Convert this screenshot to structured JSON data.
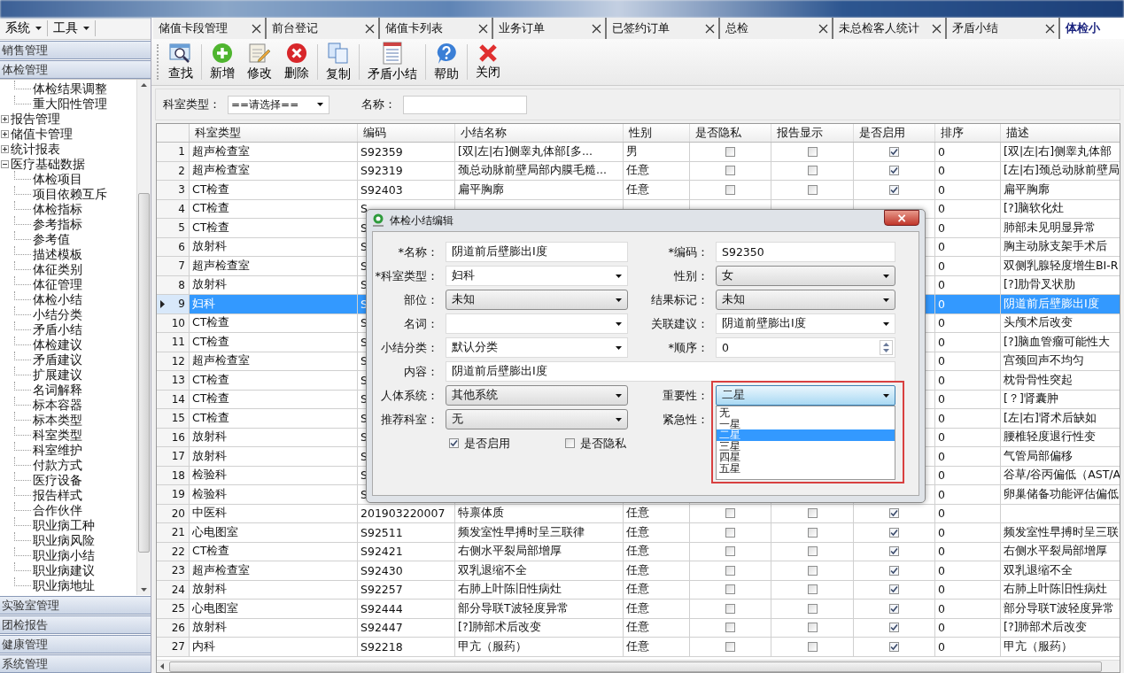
{
  "menu_bar": [
    {
      "label": "系统"
    },
    {
      "label": "工具"
    }
  ],
  "sidebar": {
    "sections_top": [
      {
        "label": "销售管理"
      },
      {
        "label": "体检管理"
      }
    ],
    "tree": {
      "scrolled_children": [
        "体检结果调整",
        "重大阳性管理"
      ],
      "nodes": [
        {
          "label": "报告管理",
          "expanded": false
        },
        {
          "label": "储值卡管理",
          "expanded": false
        },
        {
          "label": "统计报表",
          "expanded": false
        },
        {
          "label": "医疗基础数据",
          "expanded": true,
          "children": [
            "体检项目",
            "项目依赖互斥",
            "体检指标",
            "参考指标",
            "参考值",
            "描述模板",
            "体征类别",
            "体征管理",
            "体检小结",
            "小结分类",
            "矛盾小结",
            "体检建议",
            "矛盾建议",
            "扩展建议",
            "名词解释",
            "标本容器",
            "标本类型",
            "科室类型",
            "科室维护",
            "付款方式",
            "医疗设备",
            "报告样式",
            "合作伙伴",
            "职业病工种",
            "职业病风险",
            "职业病小结",
            "职业病建议",
            "职业病地址"
          ]
        }
      ]
    },
    "sections_bottom": [
      {
        "label": "实验室管理"
      },
      {
        "label": "团检报告"
      },
      {
        "label": "健康管理"
      },
      {
        "label": "系统管理"
      }
    ]
  },
  "tabs": [
    {
      "label": "储值卡段管理",
      "selected": false
    },
    {
      "label": "前台登记",
      "selected": false
    },
    {
      "label": "储值卡列表",
      "selected": false
    },
    {
      "label": "业务订单",
      "selected": false
    },
    {
      "label": "已签约订单",
      "selected": false
    },
    {
      "label": "总检",
      "selected": false
    },
    {
      "label": "未总检客人统计",
      "selected": false
    },
    {
      "label": "矛盾小结",
      "selected": false
    },
    {
      "label": "体检小",
      "selected": true
    }
  ],
  "toolbar": [
    {
      "label": "查找",
      "kind": "search"
    },
    {
      "label": "新增",
      "kind": "add"
    },
    {
      "label": "修改",
      "kind": "edit"
    },
    {
      "label": "删除",
      "kind": "delete"
    },
    {
      "label": "复制",
      "kind": "copy"
    },
    {
      "label": "矛盾小结",
      "kind": "list"
    },
    {
      "label": "帮助",
      "kind": "help"
    },
    {
      "label": "关闭",
      "kind": "close"
    }
  ],
  "filter": [
    {
      "label": "科室类型：",
      "kind": "select",
      "value": "==请选择=="
    },
    {
      "label": "名称：",
      "kind": "text"
    }
  ],
  "table": {
    "columns": [
      "科室类型",
      "编码",
      "小结名称",
      "性别",
      "是否隐私",
      "报告显示",
      "是否启用",
      "排序",
      "描述"
    ],
    "rows": [
      {
        "number": "1",
        "selected": false,
        "department": "超声检查室",
        "code": "S92359",
        "summary_name": "[双|左|右]侧睾丸体部[多...",
        "sex": "男",
        "private": false,
        "report_shown": false,
        "enabled": true,
        "sort": "0",
        "description": "[双|左|右]侧睾丸体部"
      },
      {
        "number": "2",
        "selected": false,
        "department": "超声检查室",
        "code": "S92319",
        "summary_name": "颈总动脉前壁局部内膜毛糙...",
        "sex": "任意",
        "private": false,
        "report_shown": false,
        "enabled": true,
        "sort": "0",
        "description": "[左|右]颈总动脉前壁局"
      },
      {
        "number": "3",
        "selected": false,
        "department": "CT检查",
        "code": "S92403",
        "summary_name": "扁平胸廓",
        "sex": "任意",
        "private": false,
        "report_shown": false,
        "enabled": true,
        "sort": "0",
        "description": "扁平胸廓"
      },
      {
        "number": "4",
        "selected": false,
        "department": "CT检查",
        "code": "S",
        "sort": "0",
        "description": "[?]脑软化灶"
      },
      {
        "number": "5",
        "selected": false,
        "department": "CT检查",
        "code": "S",
        "sort": "0",
        "description": "肺部未见明显异常"
      },
      {
        "number": "6",
        "selected": false,
        "department": "放射科",
        "code": "S",
        "sort": "0",
        "description": "胸主动脉支架手术后"
      },
      {
        "number": "7",
        "selected": false,
        "department": "超声检查室",
        "code": "S",
        "sort": "0",
        "description": "双侧乳腺轻度增生BI-R"
      },
      {
        "number": "8",
        "selected": false,
        "department": "放射科",
        "code": "S",
        "sort": "0",
        "description": "[?]肋骨叉状肋"
      },
      {
        "number": "9",
        "selected": true,
        "department": "妇科",
        "code": "S",
        "sort": "0",
        "description": "阴道前后壁膨出I度"
      },
      {
        "number": "10",
        "selected": false,
        "department": "CT检查",
        "code": "S",
        "sort": "0",
        "description": "头颅术后改变"
      },
      {
        "number": "11",
        "selected": false,
        "department": "CT检查",
        "code": "S",
        "sort": "0",
        "description": "[?]脑血管瘤可能性大"
      },
      {
        "number": "12",
        "selected": false,
        "department": "超声检查室",
        "code": "S",
        "sort": "0",
        "description": "宫颈回声不均匀"
      },
      {
        "number": "13",
        "selected": false,
        "department": "CT检查",
        "code": "S",
        "sort": "0",
        "description": "枕骨骨性突起"
      },
      {
        "number": "14",
        "selected": false,
        "department": "CT检查",
        "code": "S",
        "sort": "0",
        "description": "[？]肾囊肿"
      },
      {
        "number": "15",
        "selected": false,
        "department": "CT检查",
        "code": "S",
        "sort": "0",
        "description": "[左|右]肾术后缺如"
      },
      {
        "number": "16",
        "selected": false,
        "department": "放射科",
        "code": "S",
        "sort": "0",
        "description": "腰椎轻度退行性变"
      },
      {
        "number": "17",
        "selected": false,
        "department": "放射科",
        "code": "S",
        "sort": "0",
        "description": "气管局部偏移"
      },
      {
        "number": "18",
        "selected": false,
        "department": "检验科",
        "code": "S",
        "sort": "0",
        "description": "谷草/谷丙偏低（AST/A"
      },
      {
        "number": "19",
        "selected": false,
        "department": "检验科",
        "code": "S",
        "sort": "0",
        "description": "卵巢储备功能评估偏低"
      },
      {
        "number": "20",
        "selected": false,
        "department": "中医科",
        "code": "201903220007",
        "summary_name": "特禀体质",
        "sex": "任意",
        "private": false,
        "report_shown": false,
        "enabled": true,
        "sort": "0"
      },
      {
        "number": "21",
        "selected": false,
        "department": "心电图室",
        "code": "S92511",
        "summary_name": "频发室性早搏时呈三联律",
        "sex": "任意",
        "private": false,
        "report_shown": false,
        "enabled": true,
        "sort": "0",
        "description": "频发室性早搏时呈三联"
      },
      {
        "number": "22",
        "selected": false,
        "department": "CT检查",
        "code": "S92421",
        "summary_name": "右侧水平裂局部增厚",
        "sex": "任意",
        "private": false,
        "report_shown": false,
        "enabled": true,
        "sort": "0",
        "description": "右侧水平裂局部增厚"
      },
      {
        "number": "23",
        "selected": false,
        "department": "超声检查室",
        "code": "S92430",
        "summary_name": "双乳退缩不全",
        "sex": "任意",
        "private": false,
        "report_shown": false,
        "enabled": true,
        "sort": "0",
        "description": "双乳退缩不全"
      },
      {
        "number": "24",
        "selected": false,
        "department": "放射科",
        "code": "S92257",
        "summary_name": "右肺上叶陈旧性病灶",
        "sex": "任意",
        "private": false,
        "report_shown": false,
        "enabled": true,
        "sort": "0",
        "description": "右肺上叶陈旧性病灶"
      },
      {
        "number": "25",
        "selected": false,
        "department": "心电图室",
        "code": "S92444",
        "summary_name": "部分导联T波轻度异常",
        "sex": "任意",
        "private": false,
        "report_shown": false,
        "enabled": true,
        "sort": "0",
        "description": "部分导联T波轻度异常"
      },
      {
        "number": "26",
        "selected": false,
        "department": "放射科",
        "code": "S92447",
        "summary_name": "[?]肺部术后改变",
        "sex": "任意",
        "private": false,
        "report_shown": false,
        "enabled": true,
        "sort": "0",
        "description": "[?]肺部术后改变"
      },
      {
        "number": "27",
        "selected": false,
        "department": "内科",
        "code": "S92218",
        "summary_name": "甲亢（服药）",
        "sex": "任意",
        "private": false,
        "report_shown": false,
        "enabled": true,
        "sort": "0",
        "description": "甲亢（服药）"
      }
    ]
  },
  "dialog": {
    "title": "体检小结编辑",
    "close": "×",
    "rows": [
      {
        "kind": "pair",
        "items": [
          {
            "label": "*名称：",
            "kind": "text",
            "value": "阴道前后壁膨出I度"
          },
          {
            "label": "*编码：",
            "kind": "text",
            "value": "S92350"
          }
        ]
      },
      {
        "kind": "pair",
        "items": [
          {
            "label": "*科室类型：",
            "kind": "combo",
            "value": "妇科"
          },
          {
            "label": "性别：",
            "kind": "select",
            "value": "女"
          }
        ]
      },
      {
        "kind": "pair",
        "items": [
          {
            "label": "部位：",
            "kind": "select",
            "value": "未知"
          },
          {
            "label": "结果标记：",
            "kind": "select",
            "value": "未知"
          }
        ]
      },
      {
        "kind": "pair",
        "items": [
          {
            "label": "名词：",
            "kind": "combo"
          },
          {
            "label": "关联建议：",
            "kind": "combo",
            "value": "阴道前壁膨出I度"
          }
        ]
      },
      {
        "kind": "pair",
        "items": [
          {
            "label": "小结分类：",
            "kind": "combo",
            "value": "默认分类"
          },
          {
            "label": "*顺序：",
            "kind": "spin",
            "value": "0"
          }
        ]
      },
      {
        "kind": "wide",
        "items": [
          {
            "label": "内容：",
            "kind": "text",
            "value": "阴道前后壁膨出I度"
          }
        ]
      },
      {
        "kind": "pair",
        "items": [
          {
            "label": "人体系统：",
            "kind": "select",
            "value": "其他系统"
          },
          {
            "label": "重要性：",
            "kind": "open_select",
            "value": "二星",
            "options": [
              {
                "label": "无",
                "selected": false
              },
              {
                "label": "一星",
                "selected": false
              },
              {
                "label": "二星",
                "selected": true
              },
              {
                "label": "三星",
                "selected": false
              },
              {
                "label": "四星",
                "selected": false
              },
              {
                "label": "五星",
                "selected": false
              }
            ]
          }
        ]
      },
      {
        "kind": "pair",
        "items": [
          {
            "label": "推荐科室：",
            "kind": "select",
            "value": "无"
          },
          {
            "label": "紧急性：",
            "kind": "covered"
          }
        ]
      },
      {
        "kind": "checks",
        "items": [
          {
            "label": "是否启用",
            "kind": "checkbox",
            "checked": true
          },
          {
            "label": "是否隐私",
            "kind": "checkbox",
            "checked": false
          }
        ]
      }
    ]
  }
}
